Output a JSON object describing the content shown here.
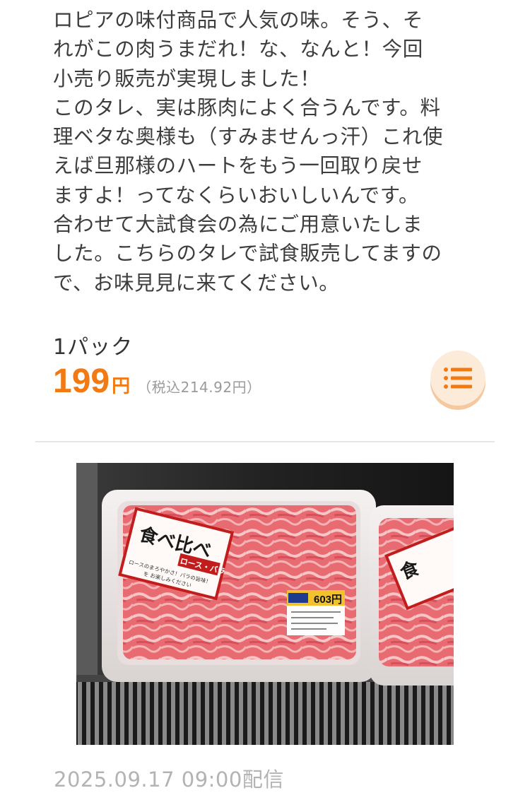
{
  "description_lines": [
    "ロピアの味付商品で人気の味。そう、そ",
    "れがこの肉うまだれ！な、なんと！今回",
    "小売り販売が実現しました！",
    "このタレ、実は豚肉によく合うんです。料",
    "理ベタな奥様も（すみませんっ汗）これ使",
    "えば旦那様のハートをもう一回取り戻せ",
    "ますよ！ってなくらいおいしいんです。",
    "合わせて大試食会の為にご用意いたしま",
    "した。こちらのタレで試食販売してますの",
    "で、お味見見に来てください。"
  ],
  "product": {
    "unit": "1パック",
    "price": "199",
    "currency": "円",
    "tax_included": "（税込214.92円）"
  },
  "menu_button": {
    "icon": "list-icon",
    "color": "#f27a14"
  },
  "photo": {
    "logo_text": "食べ比べ",
    "logo_sub": "ロース・バラ",
    "tag_line1": "ロースのまろやかさ！バラの旨味！",
    "tag_line2": "を お楽しみください",
    "price_label": "603円"
  },
  "timestamp": "2025.09.17 09:00配信",
  "colors": {
    "accent": "#f27a14",
    "text": "#3d3d3d",
    "muted": "#b3b3b3"
  }
}
